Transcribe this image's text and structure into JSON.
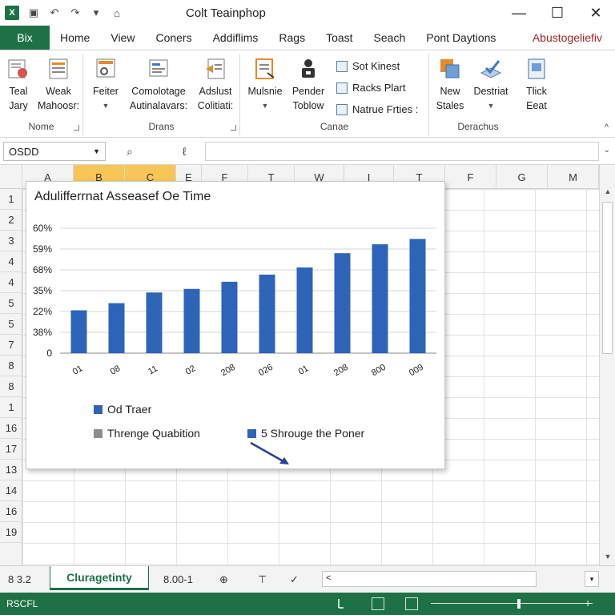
{
  "window": {
    "title": "Colt Teainphop",
    "app_icon_text": "X",
    "controls": {
      "minimize": "—",
      "maximize": "☐",
      "close": "✕"
    }
  },
  "quick_access": {
    "save": "▣",
    "undo": "↶",
    "redo": "↷",
    "customize": "▾",
    "touch": "⌂"
  },
  "tabs": {
    "file": "Bix",
    "items": [
      "Home",
      "View",
      "Coners",
      "Addiflims",
      "Rags",
      "Toast",
      "Seach",
      "Pont Daytions"
    ],
    "user": "Abustogeliefiv"
  },
  "ribbon": {
    "groups": {
      "nome": {
        "label": "Nome",
        "buttons": [
          {
            "line1": "Teal",
            "line2": "Jary"
          },
          {
            "line1": "Weak",
            "line2": "Mahoosr:"
          }
        ]
      },
      "drans": {
        "label": "Drans",
        "buttons": [
          {
            "line1": "Feiter",
            "line2": ""
          },
          {
            "line1": "Comolotage",
            "line2": "Autinalavars:"
          },
          {
            "line1": "Adslust",
            "line2": "Colitiati:"
          }
        ]
      },
      "canae": {
        "label": "Canae",
        "buttons": [
          {
            "line1": "Mulsnie",
            "line2": ""
          },
          {
            "line1": "Pender",
            "line2": "Toblow"
          }
        ],
        "small": [
          "Sot Kinest",
          "Racks Plart",
          "Natrue Frties :"
        ]
      },
      "derachus": {
        "label": "Derachus",
        "buttons": [
          {
            "line1": "New",
            "line2": "Stales"
          },
          {
            "line1": "Destriat",
            "line2": ""
          },
          {
            "line1": "Tlick",
            "line2": "Eeat"
          }
        ]
      }
    },
    "collapse": "^"
  },
  "formula_bar": {
    "name_box": "OSDD",
    "btn_a": "⌕",
    "btn_b": "ℓ",
    "value": "",
    "expand": "⌄"
  },
  "grid": {
    "columns": [
      "A",
      "B",
      "C",
      "E",
      "F",
      "T",
      "W",
      "I",
      "T",
      "F",
      "G",
      "M"
    ],
    "rows": [
      "1",
      "2",
      "3",
      "4",
      "4",
      "5",
      "5",
      "7",
      "8",
      "8",
      "1",
      "16",
      "17",
      "13",
      "14",
      "16",
      "19"
    ]
  },
  "chart_data": {
    "type": "bar",
    "title": "Adulifferrnat Asseasef Oe Time",
    "y_tick_labels": [
      "60%",
      "59%",
      "68%",
      "35%",
      "22%",
      "38%",
      "0"
    ],
    "categories": [
      "01",
      "08",
      "11",
      "02",
      "208",
      "026",
      "01",
      "208",
      "800",
      "009"
    ],
    "values": [
      24,
      28,
      34,
      36,
      40,
      44,
      48,
      56,
      61,
      64
    ],
    "ylim": [
      0,
      70
    ],
    "grid": true,
    "legend": {
      "position": "bottom",
      "entries": [
        {
          "name": "Od Traer",
          "color": "#2e64b8"
        },
        {
          "name": "Threnge Quabition",
          "color": "#8c8c8c"
        },
        {
          "name": "5 Shrouge the Poner",
          "color": "#2e64b8"
        }
      ]
    },
    "series_color": "#2e64b8"
  },
  "sheets": {
    "nav": "8 3.2",
    "active": "Cluragetinty",
    "extra": "8.00-1",
    "btn_a": "⊕",
    "btn_b": "⊤",
    "btn_c": "✓",
    "scroll_left": "<",
    "scroll_dd": "▾"
  },
  "status": {
    "text": "RSCFL",
    "zoom_minus": "−",
    "zoom_plus": "+"
  }
}
